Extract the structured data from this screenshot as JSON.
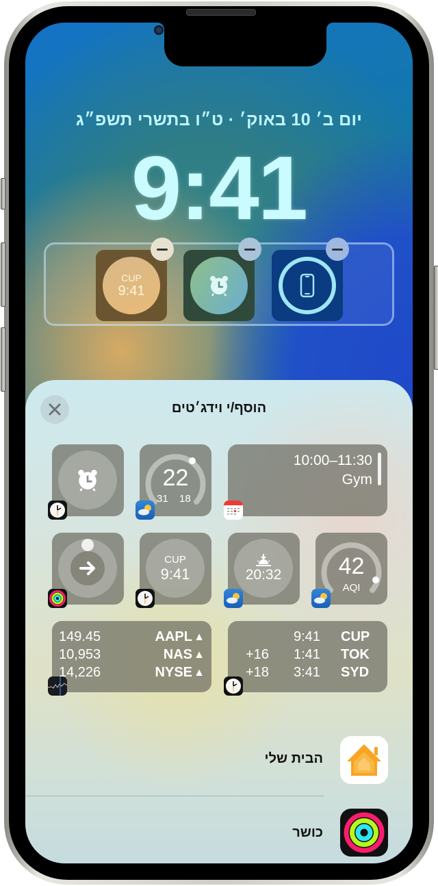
{
  "lock_screen": {
    "date_line": "יום ב׳ 10 באוק׳ · ט״ו בתשרי תשפ״ג",
    "time": "9:41",
    "widgets": [
      {
        "type": "world-clock",
        "city": "CUP",
        "time": "9:41"
      },
      {
        "type": "alarm",
        "icon": "alarm-clock-icon"
      },
      {
        "type": "battery",
        "icon": "iphone-icon",
        "level": 1.0
      }
    ],
    "remove_icon": "minus-icon"
  },
  "sheet": {
    "title": "הוסף/י וידג׳טים",
    "close_icon": "close-icon",
    "suggestions": {
      "row1": {
        "alarm": {
          "icon": "alarm-clock-icon",
          "app": "clock"
        },
        "weather_temp": {
          "temp": "22",
          "high": "31",
          "low": "18",
          "app": "weather"
        },
        "calendar": {
          "time_range": "10:00–11:30",
          "event": "Gym",
          "app": "calendar"
        }
      },
      "row2": {
        "activity": {
          "icon": "arrow-right-icon",
          "app": "fitness"
        },
        "clock": {
          "city": "CUP",
          "time": "9:41",
          "app": "clock"
        },
        "sunset": {
          "icon": "sunset-icon",
          "time": "20:32",
          "app": "weather"
        },
        "aqi": {
          "value": "42",
          "label": "AQI",
          "app": "weather"
        }
      },
      "row3": {
        "stocks": {
          "app": "stocks",
          "rows": [
            {
              "symbol": "AAPL",
              "value": "149.45",
              "trend": "▲"
            },
            {
              "symbol": "NAS",
              "value": "10,953",
              "trend": "▲"
            },
            {
              "symbol": "NYSE",
              "value": "14,226",
              "trend": "▲"
            }
          ]
        },
        "world_clock": {
          "app": "clock",
          "rows": [
            {
              "city": "CUP",
              "time": "9:41",
              "offset": ""
            },
            {
              "city": "TOK",
              "time": "1:41",
              "offset": "+16"
            },
            {
              "city": "SYD",
              "time": "3:41",
              "offset": "+18"
            }
          ]
        }
      }
    },
    "apps": [
      {
        "label": "הבית שלי",
        "icon": "home-app-icon"
      },
      {
        "label": "כושר",
        "icon": "fitness-app-icon"
      }
    ]
  }
}
